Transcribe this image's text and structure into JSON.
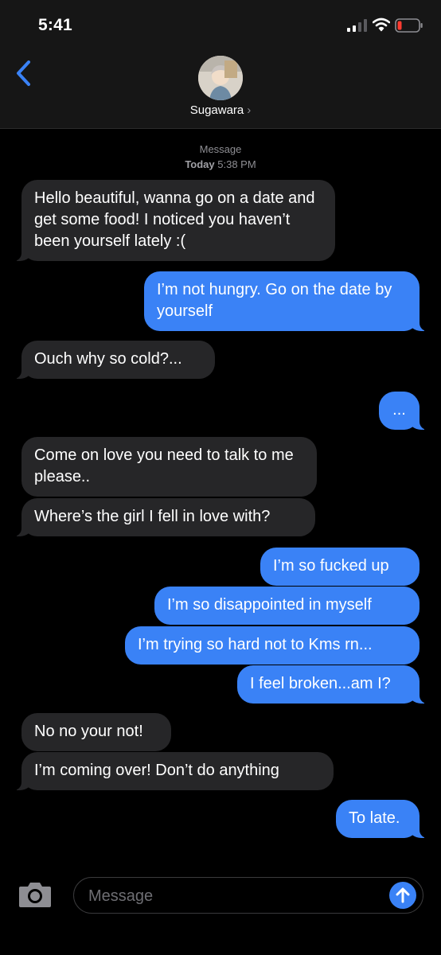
{
  "status": {
    "time": "5:41"
  },
  "header": {
    "contact_name": "Sugawara",
    "chevron": "›"
  },
  "thread": {
    "service_label": "Message",
    "day_label": "Today",
    "time_label": "5:38 PM"
  },
  "messages": [
    {
      "dir": "in",
      "text": "Hello beautiful, wanna go on a date and get some food! I noticed you haven’t been yourself lately :("
    },
    {
      "dir": "out",
      "text": "I’m not hungry. Go on the date by yourself"
    },
    {
      "dir": "in",
      "text": "Ouch why so cold?..."
    },
    {
      "dir": "out",
      "text": "..."
    },
    {
      "dir": "in",
      "text": "Come on love you need to talk to me please.."
    },
    {
      "dir": "in",
      "text": "Where’s the girl I fell in love with?"
    },
    {
      "dir": "out",
      "text": "I’m so fucked up"
    },
    {
      "dir": "out",
      "text": "I’m so disappointed in myself"
    },
    {
      "dir": "out",
      "text": "I’m trying so hard not to Kms rn..."
    },
    {
      "dir": "out",
      "text": "I feel broken...am I?"
    },
    {
      "dir": "in",
      "text": "No no your not!"
    },
    {
      "dir": "in",
      "text": "I’m coming over! Don’t do anything"
    },
    {
      "dir": "out",
      "text": "To late."
    }
  ],
  "composer": {
    "placeholder": "Message"
  },
  "icons": {
    "back": "chevron-left-icon",
    "camera": "camera-icon",
    "send": "arrow-up-icon",
    "signal": "cellular-signal-icon",
    "wifi": "wifi-icon",
    "battery": "battery-low-icon"
  },
  "colors": {
    "outgoing_bubble": "#3a82f6",
    "incoming_bubble": "#262628",
    "battery_low": "#ff3b30",
    "accent": "#3a82f6"
  }
}
